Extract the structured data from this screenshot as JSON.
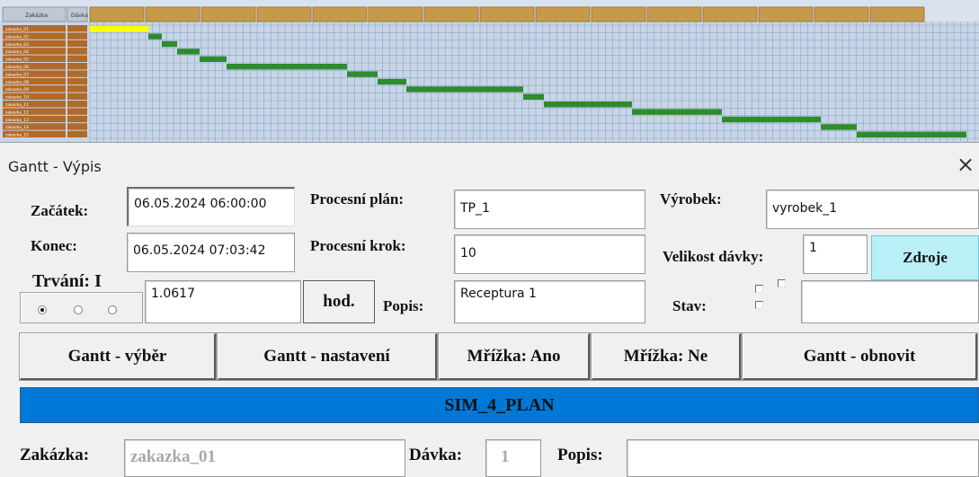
{
  "sheet": {
    "header_cells": [
      "Zakázka",
      "Dávka"
    ],
    "row_labels": [
      "zakazka_01",
      "zakazka_02",
      "zakazka_03",
      "zakazka_04",
      "zakazka_05",
      "zakazka_06",
      "zakazka_07",
      "zakazka_08",
      "zakazka_09",
      "zakazka_10",
      "zakazka_11",
      "zakazka_12",
      "zakazka_13",
      "zakazka_14",
      "zakazka_15"
    ],
    "colors": {
      "active_bar": "#ffff00",
      "bar": "#2e8b2e",
      "grid": "#8aa6c8",
      "header": "#c79a4a",
      "row_label_bg": "#b06a2a"
    }
  },
  "dialog": {
    "title": "Gantt - Výpis",
    "close_label": "×",
    "fields": {
      "zacatek_label": "Začátek:",
      "zacatek_value": "06.05.2024 06:00:00",
      "konec_label": "Konec:",
      "konec_value": "06.05.2024 07:03:42",
      "trvani_label": "Trvání: I",
      "trvani_value": "1.0617",
      "hod_label": "hod.",
      "procesni_plan_label": "Procesní plán:",
      "procesni_plan_value": "TP_1",
      "procesni_krok_label": "Procesní krok:",
      "procesni_krok_value": "10",
      "popis_label": "Popis:",
      "popis_value": "Receptura 1",
      "vyrobek_label": "Výrobek:",
      "vyrobek_value": "vyrobek_1",
      "velikost_label": "Velikost dávky:",
      "velikost_value": "1",
      "zdroje_label": "Zdroje",
      "stav_label": "Stav:",
      "stav_value": ""
    },
    "buttons": {
      "vyber": "Gantt - výběr",
      "nastaveni": "Gantt - nastavení",
      "mrizka_ano": "Mřížka: Ano",
      "mrizka_ne": "Mřížka: Ne",
      "obnovit": "Gantt - obnovit"
    },
    "plan_name": "SIM_4_PLAN",
    "bottom": {
      "zakazka_label": "Zakázka:",
      "zakazka_value": "zakazka_01",
      "davka_label": "Dávka:",
      "davka_value": "1",
      "popis_label": "Popis:",
      "popis_value": ""
    },
    "accent_color": "#0078d7",
    "zdroje_color": "#b9f0f7"
  }
}
